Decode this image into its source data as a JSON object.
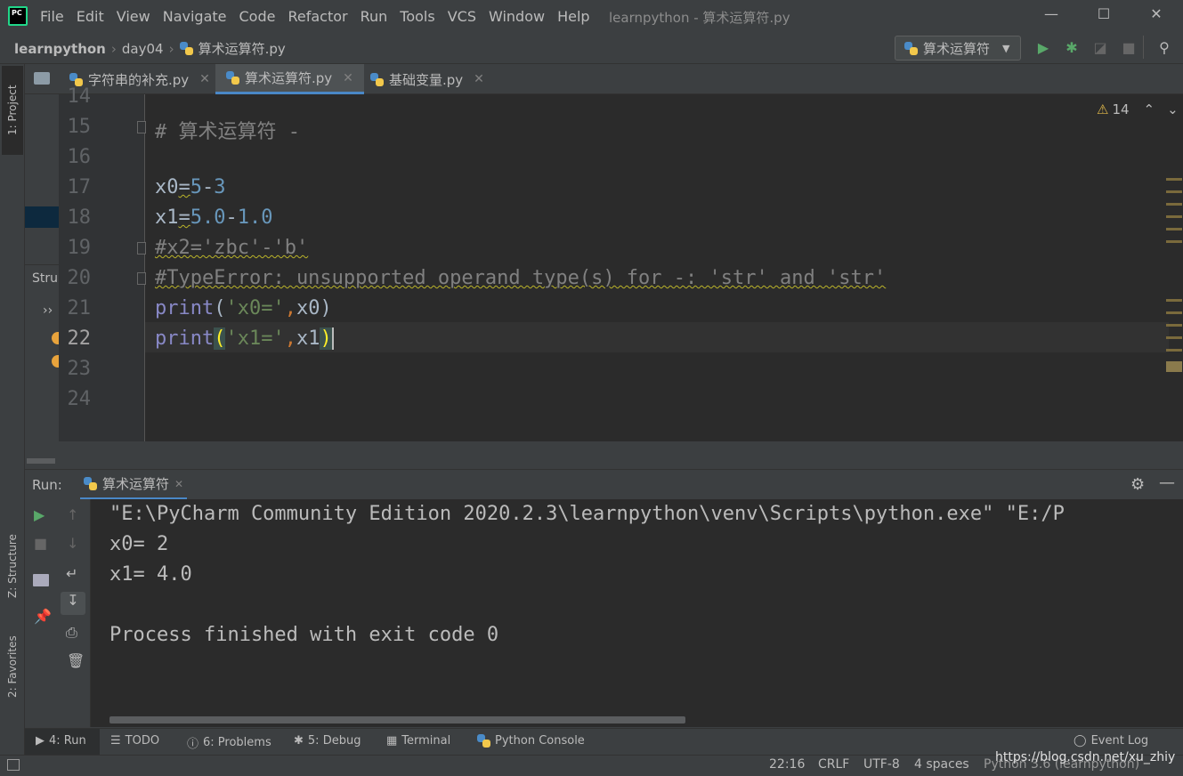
{
  "app": {
    "title": "learnpython - 算术运算符.py",
    "logo_text": "PC"
  },
  "menu": [
    "File",
    "Edit",
    "View",
    "Navigate",
    "Code",
    "Refactor",
    "Run",
    "Tools",
    "VCS",
    "Window",
    "Help"
  ],
  "breadcrumb": {
    "project": "learnpython",
    "folder": "day04",
    "file": "算术运算符.py"
  },
  "run_config": {
    "name": "算术运算符"
  },
  "tabs": [
    {
      "label": "字符串的补充.py",
      "active": false
    },
    {
      "label": "算术运算符.py",
      "active": true
    },
    {
      "label": "基础变量.py",
      "active": false
    }
  ],
  "left_strip": {
    "project": "1: Project",
    "structure": "Z: Structure",
    "favorites": "2: Favorites",
    "stru": "Stru"
  },
  "editor": {
    "warnings": "14",
    "lines": [
      {
        "n": "14"
      },
      {
        "n": "15"
      },
      {
        "n": "16"
      },
      {
        "n": "17"
      },
      {
        "n": "18"
      },
      {
        "n": "19"
      },
      {
        "n": "20"
      },
      {
        "n": "21"
      },
      {
        "n": "22"
      },
      {
        "n": "23"
      },
      {
        "n": "24"
      }
    ],
    "code": {
      "l15": "# 算术运算符 -",
      "l17a": "x0",
      "l17b": "=",
      "l17c": "5",
      "l17d": "-",
      "l17e": "3",
      "l18a": "x1",
      "l18b": "=",
      "l18c": "5.0",
      "l18d": "-",
      "l18e": "1.0",
      "l19": "#x2='zbc'-'b'",
      "l20": "#TypeError: unsupported operand type(s) for -: 'str' and 'str'",
      "l21a": "print",
      "l21b": "(",
      "l21c": "'x0='",
      "l21d": ",",
      "l21e": "x0",
      "l21f": ")",
      "l22a": "print",
      "l22b": "(",
      "l22c": "'x1='",
      "l22d": ",",
      "l22e": "x1",
      "l22f": ")"
    }
  },
  "run": {
    "label": "Run:",
    "tab": "算术运算符",
    "output": [
      "\"E:\\PyCharm Community Edition 2020.2.3\\learnpython\\venv\\Scripts\\python.exe\" \"E:/P",
      "x0= 2",
      "x1= 4.0",
      "",
      "Process finished with exit code 0"
    ]
  },
  "toolwindows": {
    "run": "4: Run",
    "todo": "TODO",
    "problems": "6: Problems",
    "debug": "5: Debug",
    "terminal": "Terminal",
    "console": "Python Console",
    "eventlog": "Event Log"
  },
  "statusbar": {
    "pos": "22:16",
    "eol": "CRLF",
    "enc": "UTF-8",
    "indent": "4 spaces",
    "interp": "Python 3.6 (learnpython)",
    "watermark": "https://blog.csdn.net/xu_zhiy"
  },
  "colors": {
    "accent": "#4a88c7",
    "run_green": "#59a869",
    "bg_editor": "#2b2b2b",
    "bg_panel": "#3c3f41"
  }
}
